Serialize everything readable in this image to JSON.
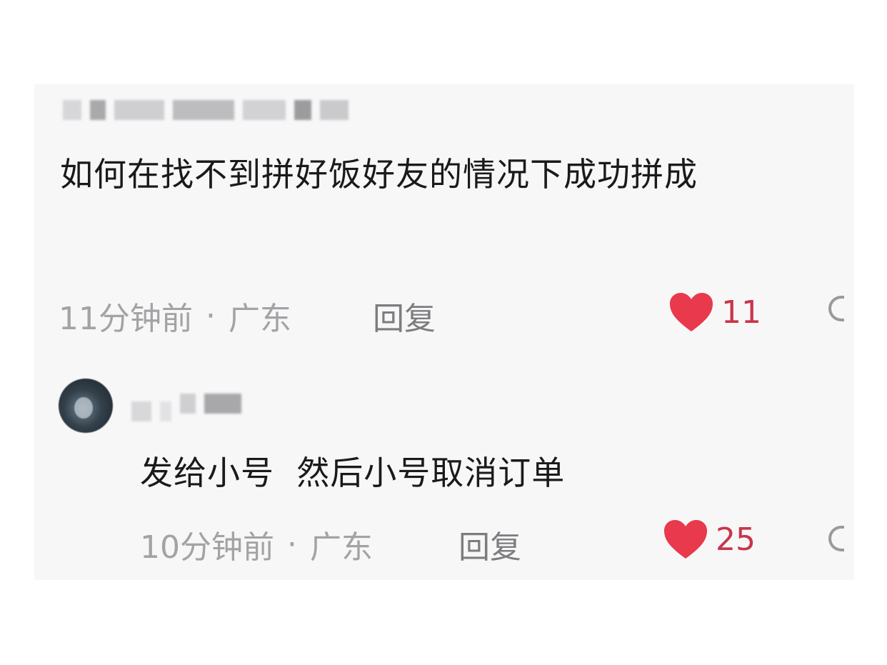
{
  "comments": [
    {
      "text": "如何在找不到拼好饭好友的情况下成功拼成",
      "time": "11分钟前",
      "separator": "·",
      "location": "广东",
      "reply_label": "回复",
      "likes": "11",
      "liked": true
    },
    {
      "text": "发给小号  然后小号取消订单",
      "time": "10分钟前",
      "separator": "·",
      "location": "广东",
      "reply_label": "回复",
      "likes": "25",
      "liked": true
    }
  ],
  "colors": {
    "heart": "#e8394d",
    "like_count": "#c9354a",
    "meta_text": "#a3a3a6",
    "body_text": "#1a1a1a"
  },
  "icons": {
    "like": "heart-icon",
    "more": "more-icon"
  }
}
